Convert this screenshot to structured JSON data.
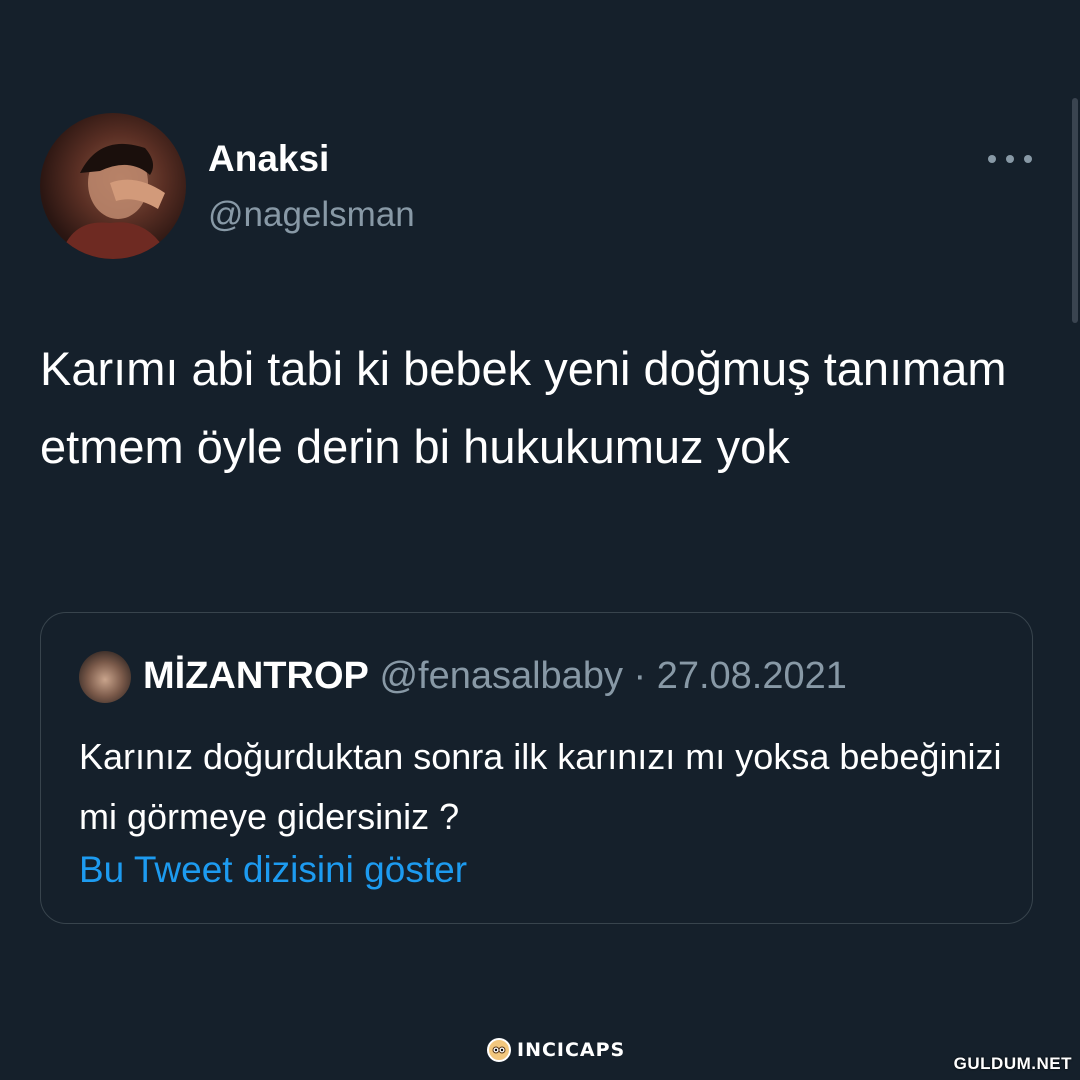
{
  "tweet": {
    "author": {
      "name": "Anaksi",
      "handle": "@nagelsman"
    },
    "text": "Karımı abi tabi ki bebek yeni doğmuş tanımam etmem öyle derin bi hukukumuz yok",
    "more_icon": "more-horizontal-icon"
  },
  "quoted_tweet": {
    "author_name": "MİZANTROP",
    "meta": "@fenasalbaby · 27.08.2021",
    "text": "Karınız doğurduktan sonra ilk karınızı mı yoksa bebeğinizi mi görmeye gidersiniz ?",
    "thread_link": "Bu Tweet dizisini göster"
  },
  "branding": {
    "app_name": "INCICAPS",
    "watermark": "GULDUM.NET"
  },
  "colors": {
    "background": "#15202b",
    "primary_text": "#ffffff",
    "secondary_text": "#8899a6",
    "border": "#38444d",
    "link": "#1d9bf0"
  }
}
